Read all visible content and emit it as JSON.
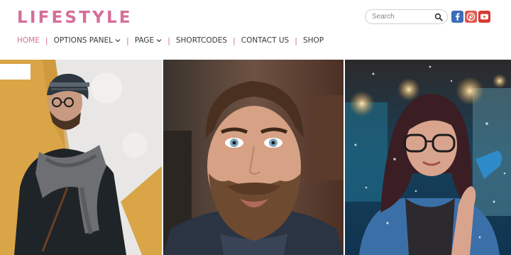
{
  "brand": {
    "logo_text": "LIFESTYLE",
    "accent_color": "#d56f97"
  },
  "search": {
    "placeholder": "Search",
    "value": "",
    "icon": "search-icon"
  },
  "social": [
    {
      "name": "facebook",
      "icon": "facebook-icon",
      "color": "#3b6db8"
    },
    {
      "name": "pinterest",
      "icon": "pinterest-icon",
      "color": "#e2574c"
    },
    {
      "name": "youtube",
      "icon": "youtube-icon",
      "color": "#d73a33"
    }
  ],
  "nav": {
    "items": [
      {
        "label": "HOME",
        "active": true,
        "dropdown": false
      },
      {
        "label": "OPTIONS PANEL",
        "active": false,
        "dropdown": true
      },
      {
        "label": "PAGE",
        "active": false,
        "dropdown": true
      },
      {
        "label": "SHORTCODES",
        "active": false,
        "dropdown": false
      },
      {
        "label": "CONTACT US",
        "active": false,
        "dropdown": false
      },
      {
        "label": "SHOP",
        "active": false,
        "dropdown": false
      }
    ]
  },
  "gallery": {
    "photos": [
      {
        "subject": "man in beanie and knitted scarf against yellow and white wall"
      },
      {
        "subject": "bearded man portrait"
      },
      {
        "subject": "woman with glasses in bokeh lights"
      }
    ]
  }
}
